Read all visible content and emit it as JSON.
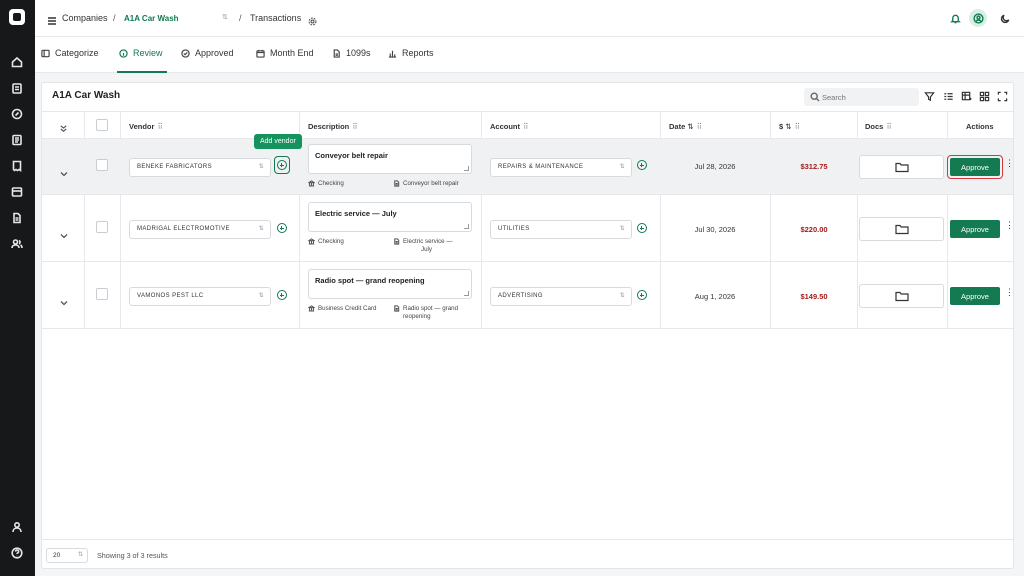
{
  "rail": {
    "icons": [
      "app-logo",
      "home-icon",
      "clipboard-icon",
      "compass-icon",
      "ledger-icon",
      "receipt-icon",
      "book-icon",
      "document-icon",
      "users-icon",
      "profile-icon",
      "help-icon"
    ]
  },
  "topbar": {
    "companies_label": "Companies",
    "separator": "/",
    "company_name": "A1A Car Wash",
    "page_label": "Transactions",
    "colors": {
      "accent": "#137a51"
    }
  },
  "tabs": [
    {
      "label": "Categorize",
      "icon": "categorize-icon"
    },
    {
      "label": "Review",
      "icon": "info-circle-icon",
      "active": true
    },
    {
      "label": "Approved",
      "icon": "check-circle-icon"
    },
    {
      "label": "Month End",
      "icon": "calendar-icon"
    },
    {
      "label": "1099s",
      "icon": "file-icon"
    },
    {
      "label": "Reports",
      "icon": "bar-chart-icon"
    }
  ],
  "panel": {
    "title": "A1A Car Wash",
    "search_placeholder": "Search"
  },
  "table": {
    "headers": {
      "vendor": "Vendor",
      "description": "Description",
      "account": "Account",
      "date": "Date",
      "amount": "$",
      "docs": "Docs",
      "actions": "Actions"
    },
    "rows": [
      {
        "vendor": "BENEKE FABRICATORS",
        "description": "Conveyor belt repair",
        "payment_account": "Checking",
        "memo": "Conveyor belt repair",
        "account": "REPAIRS & MAINTENANCE",
        "date": "Jul 28, 2026",
        "amount": "$312.75",
        "action": "Approve"
      },
      {
        "vendor": "MADRIGAL ELECTROMOTIVE",
        "description": "Electric service — July",
        "payment_account": "Checking",
        "memo_line1": "Electric service —",
        "memo_line2": "July",
        "account": "UTILITIES",
        "date": "Jul 30, 2026",
        "amount": "$220.00",
        "action": "Approve"
      },
      {
        "vendor": "VAMONOS PEST LLC",
        "description": "Radio spot — grand reopening",
        "payment_account": "Business Credit Card",
        "memo_line1": "Radio spot — grand",
        "memo_line2": "reopening",
        "account": "ADVERTISING",
        "date": "Aug 1, 2026",
        "amount": "$149.50",
        "action": "Approve"
      }
    ]
  },
  "tooltip": "Add vendor",
  "footer": {
    "page_size": "20",
    "showing": "Showing 3 of 3 results"
  }
}
